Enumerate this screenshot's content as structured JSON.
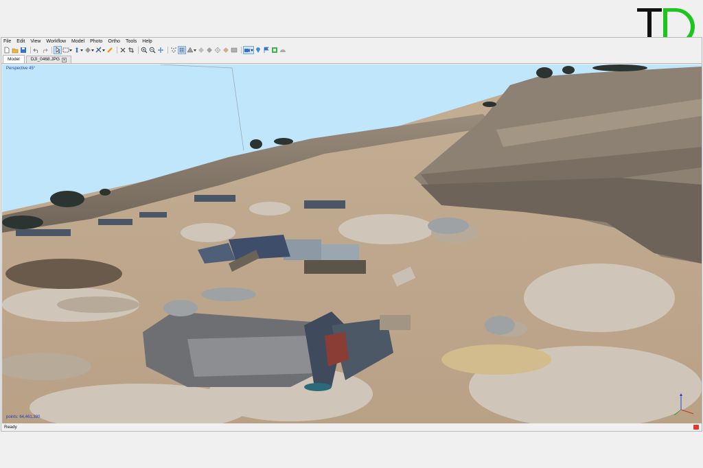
{
  "logo": {
    "text_1": "T",
    "text_2": "D",
    "color_1": "#111111",
    "color_2": "#1ec51e"
  },
  "menu": [
    "File",
    "Edit",
    "View",
    "Workflow",
    "Model",
    "Photo",
    "Ortho",
    "Tools",
    "Help"
  ],
  "tabs": [
    {
      "label": "Model",
      "active": true
    },
    {
      "label": "DJI_0468.JPG",
      "active": false
    }
  ],
  "viewport": {
    "projection_label": "Perspective 45°",
    "points_label": "points: 64,461,380",
    "sky_color": "#bfe6fb"
  },
  "status": {
    "text": "Ready"
  }
}
